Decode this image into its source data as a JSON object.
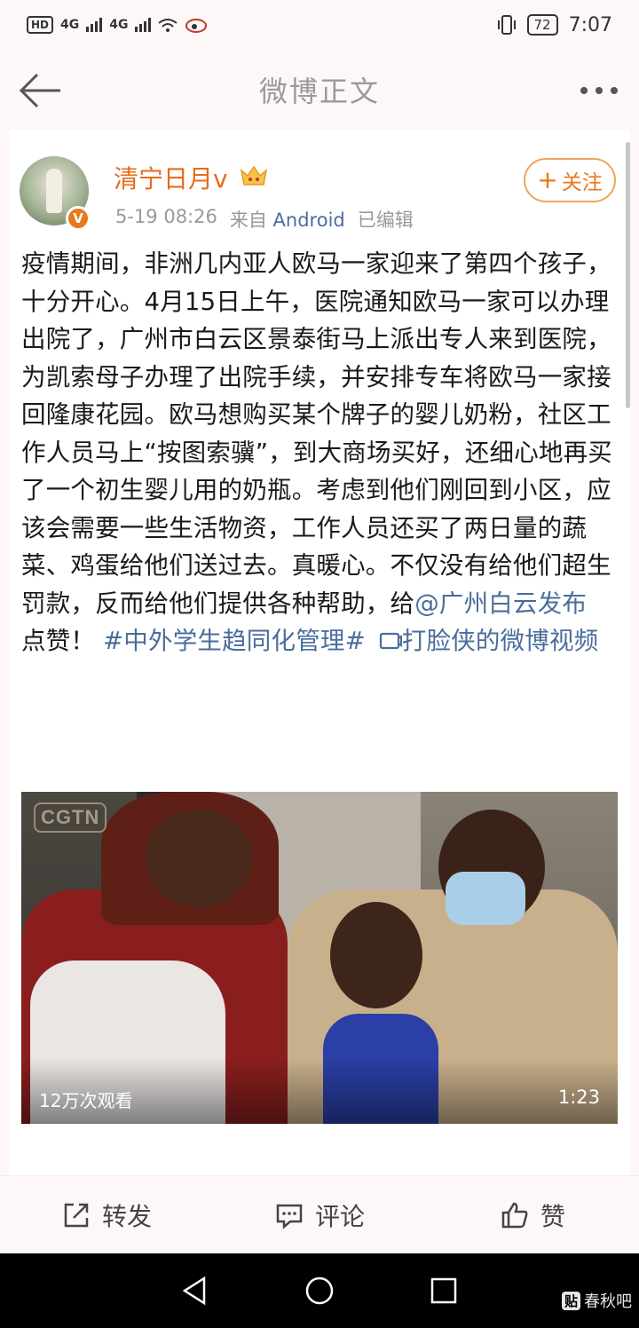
{
  "status_bar": {
    "left_icons": [
      "HD",
      "4G",
      "4G"
    ],
    "battery": "72",
    "time": "7:07"
  },
  "nav": {
    "title": "微博正文"
  },
  "post": {
    "user_name": "清宁日月v",
    "time": "5-19 08:26",
    "source_prefix": "来自",
    "source": "Android",
    "edited": "已编辑",
    "follow_label": "关注",
    "text": "疫情期间，非洲几内亚人欧马一家迎来了第四个孩子，十分开心。4月15日上午，医院通知欧马一家可以办理出院了，广州市白云区景泰街马上派出专人来到医院，为凯索母子办理了出院手续，并安排专车将欧马一家接回隆康花园。欧马想购买某个牌子的婴儿奶粉，社区工作人员马上“按图索骥”，到大商场买好，还细心地再买了一个初生婴儿用的奶瓶。考虑到他们刚回到小区，应该会需要一些生活物资，工作人员还买了两日量的蔬菜、鸡蛋给他们送过去。真暖心。不仅没有给他们超生罚款，反而给他们提供各种帮助，给",
    "mention": "@广州白云发布",
    "text_after_mention": " 点赞！ ",
    "hashtag": "#中外学生趋同化管理#",
    "video_link": "打脸侠的微博视频"
  },
  "video": {
    "logo": "CGTN",
    "views": "12万次观看",
    "duration": "1:23"
  },
  "actions": {
    "repost": "转发",
    "comment": "评论",
    "like": "赞"
  },
  "watermark": {
    "badge": "贴",
    "text": "春秋吧"
  },
  "colors": {
    "accent_orange": "#e8791a",
    "link_blue": "#4a6d9a"
  }
}
